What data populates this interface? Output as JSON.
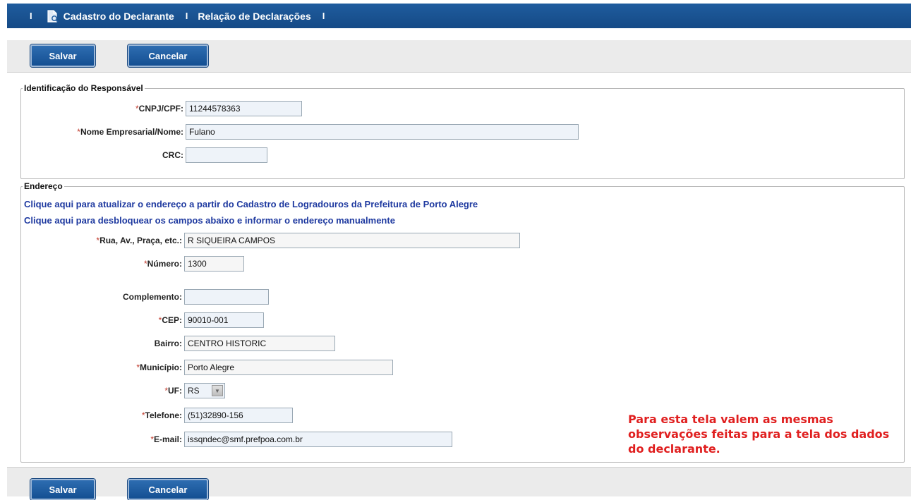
{
  "nav": {
    "separator": "I",
    "links": [
      {
        "label": "Cadastro do Declarante",
        "icon": "document-icon"
      },
      {
        "label": "Relação de Declarações"
      }
    ]
  },
  "toolbar": {
    "save_label": "Salvar",
    "cancel_label": "Cancelar"
  },
  "responsavel": {
    "legend": "Identificação do Responsável",
    "cnpj_label": "CNPJ/CPF:",
    "cnpj_value": "11244578363",
    "nome_label": "Nome Empresarial/Nome:",
    "nome_value": "Fulano",
    "crc_label": "CRC:",
    "crc_value": ""
  },
  "endereco": {
    "legend": "Endereço",
    "link_atualizar": "Clique aqui para atualizar o endereço a partir do Cadastro de Logradouros da Prefeitura de Porto Alegre",
    "link_desbloquear": "Clique aqui para desbloquear os campos abaixo e informar o endereço manualmente",
    "rua_label": "Rua, Av., Praça, etc.:",
    "rua_value": "R SIQUEIRA CAMPOS",
    "numero_label": "Número:",
    "numero_value": "1300",
    "complemento_label": "Complemento:",
    "complemento_value": "",
    "cep_label": "CEP:",
    "cep_value": "90010-001",
    "bairro_label": "Bairro:",
    "bairro_value": "CENTRO HISTORIC",
    "municipio_label": "Município:",
    "municipio_value": "Porto Alegre",
    "uf_label": "UF:",
    "uf_value": "RS",
    "telefone_label": "Telefone:",
    "telefone_value": "(51)32890-156",
    "email_label": "E-mail:",
    "email_value": "issqndec@smf.prefpoa.com.br"
  },
  "required_marker": "*",
  "note": "Para esta tela valem as mesmas observações feitas para a tela dos dados do declarante."
}
